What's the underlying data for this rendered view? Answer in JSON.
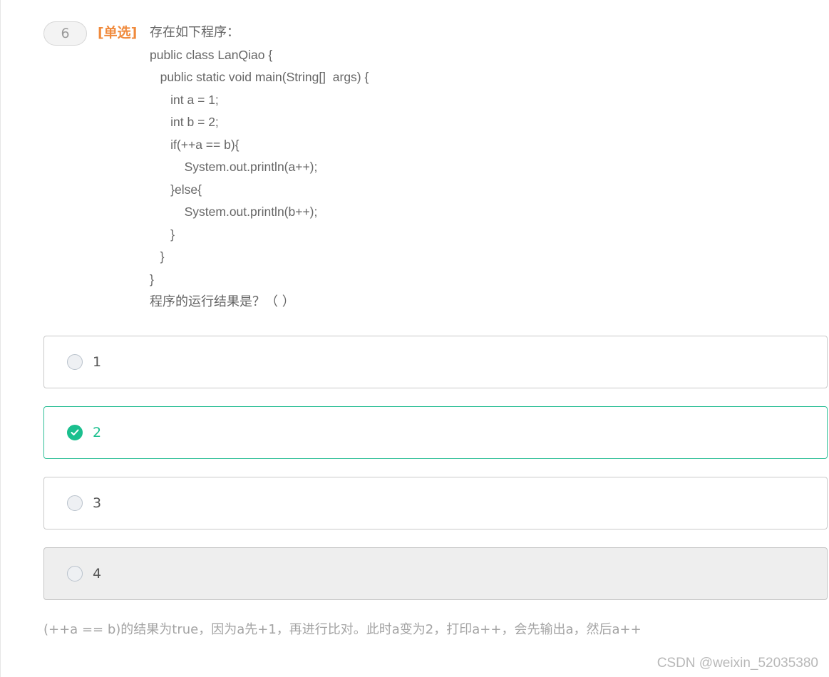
{
  "question": {
    "number": "6",
    "type_label": "[单选]",
    "lines": [
      "存在如下程序：",
      "public class LanQiao {",
      "   public static void main(String[]  args) {",
      "      int a = 1;",
      "      int b = 2;",
      "      if(++a == b){",
      "          System.out.println(a++);",
      "      }else{",
      "          System.out.println(b++);",
      "      }",
      "   }",
      "}",
      "程序的运行结果是？（ ）"
    ]
  },
  "options": [
    {
      "label": "1",
      "selected": false
    },
    {
      "label": "2",
      "selected": true
    },
    {
      "label": "3",
      "selected": false
    },
    {
      "label": "4",
      "selected": false
    }
  ],
  "explanation": "(++a == b)的结果为true，因为a先+1，再进行比对。此时a变为2，打印a++，会先输出a，然后a++",
  "watermark": "CSDN @weixin_52035380",
  "colors": {
    "accent": "#1bbf8e",
    "type_label": "#f08a3c",
    "text": "#666666",
    "muted": "#a3a3a3"
  }
}
